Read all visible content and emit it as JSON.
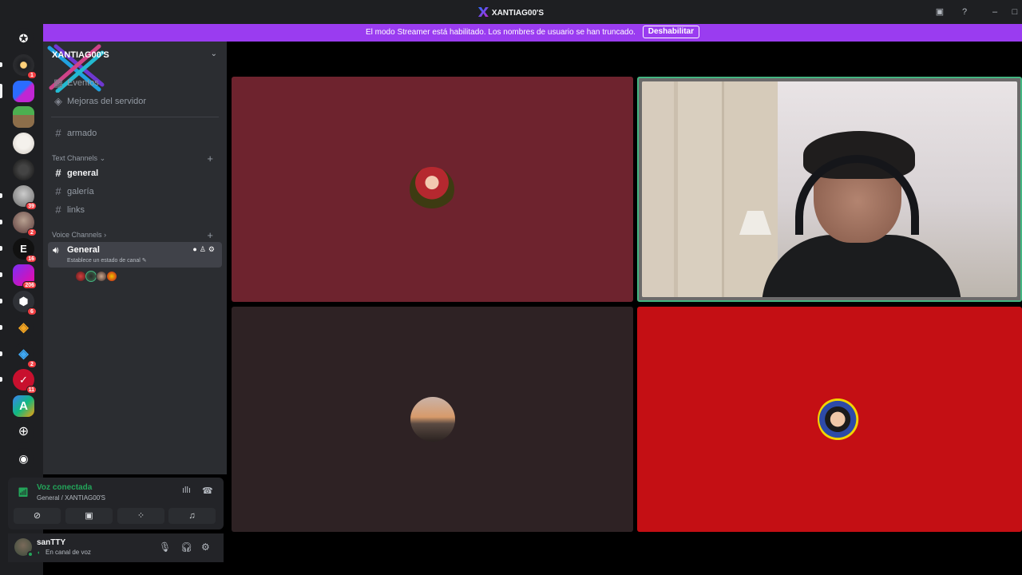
{
  "window": {
    "title": "XANTIAG00'S"
  },
  "banner": {
    "message": "El modo Streamer está habilitado. Los nombres de usuario se han truncado.",
    "button_label": "Deshabilitar"
  },
  "server_rail": {
    "badges": [
      "1",
      "",
      "",
      "",
      "",
      "39",
      "2",
      "16",
      "206",
      "6",
      "",
      "2",
      "11",
      ""
    ]
  },
  "server": {
    "name": "XANTIAG00'S",
    "events_label": "Eventos",
    "boosts_label": "Mejoras del servidor"
  },
  "channels": {
    "top": [
      {
        "name": "armado"
      }
    ],
    "text_category": "Text Channels",
    "text": [
      {
        "name": "general",
        "active": true
      },
      {
        "name": "galería",
        "active": false
      },
      {
        "name": "links",
        "active": false
      }
    ],
    "voice_category": "Voice Channels",
    "voice": {
      "name": "General",
      "status_placeholder": "Establece un estado de canal"
    }
  },
  "voice_panel": {
    "status": "Voz conectada",
    "location": "General / XANTIAG00'S"
  },
  "user": {
    "name": "sanTTY",
    "status": "En canal de voz"
  },
  "colors": {
    "tile1": "#6e232e",
    "tile2": "#2e2224",
    "tile3": "#c40f14",
    "speaking": "#43b581",
    "banner": "#9a3cf0"
  }
}
